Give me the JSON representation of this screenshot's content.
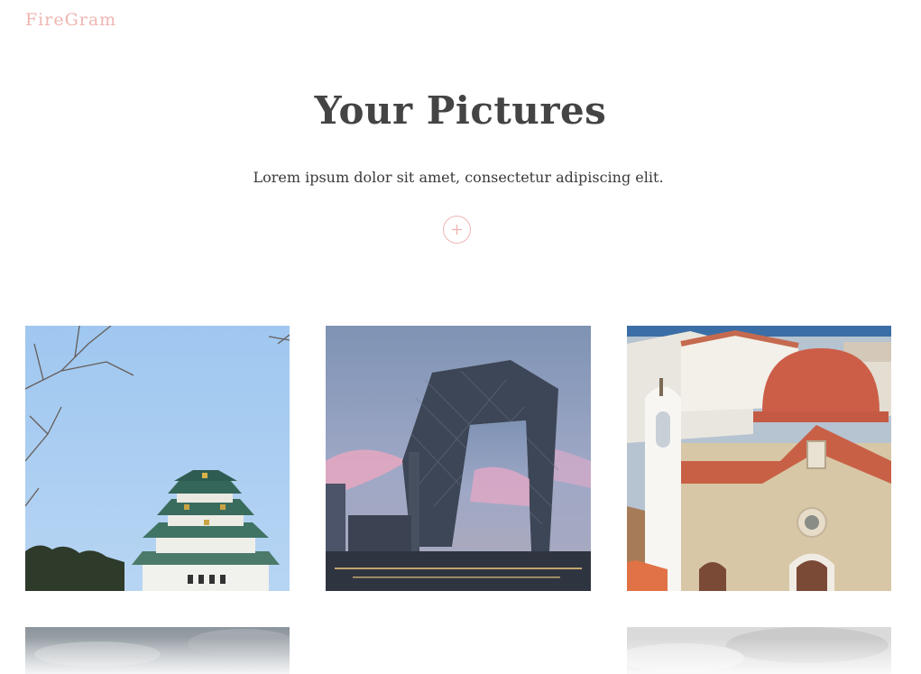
{
  "header": {
    "brand": "FireGram"
  },
  "hero": {
    "title": "Your Pictures",
    "subtitle": "Lorem ipsum dolor sit amet, consectetur adipiscing elit.",
    "upload_icon": "plus-icon"
  },
  "colors": {
    "accent": "#efb6b2",
    "heading": "#444444"
  },
  "gallery": {
    "images": [
      {
        "subject": "japanese-castle-photo"
      },
      {
        "subject": "cctv-tower-photo"
      },
      {
        "subject": "red-dome-church-photo"
      },
      {
        "subject": "cloudy-sky-photo"
      },
      {
        "subject": "empty-slot"
      },
      {
        "subject": "grey-sky-photo"
      }
    ]
  }
}
